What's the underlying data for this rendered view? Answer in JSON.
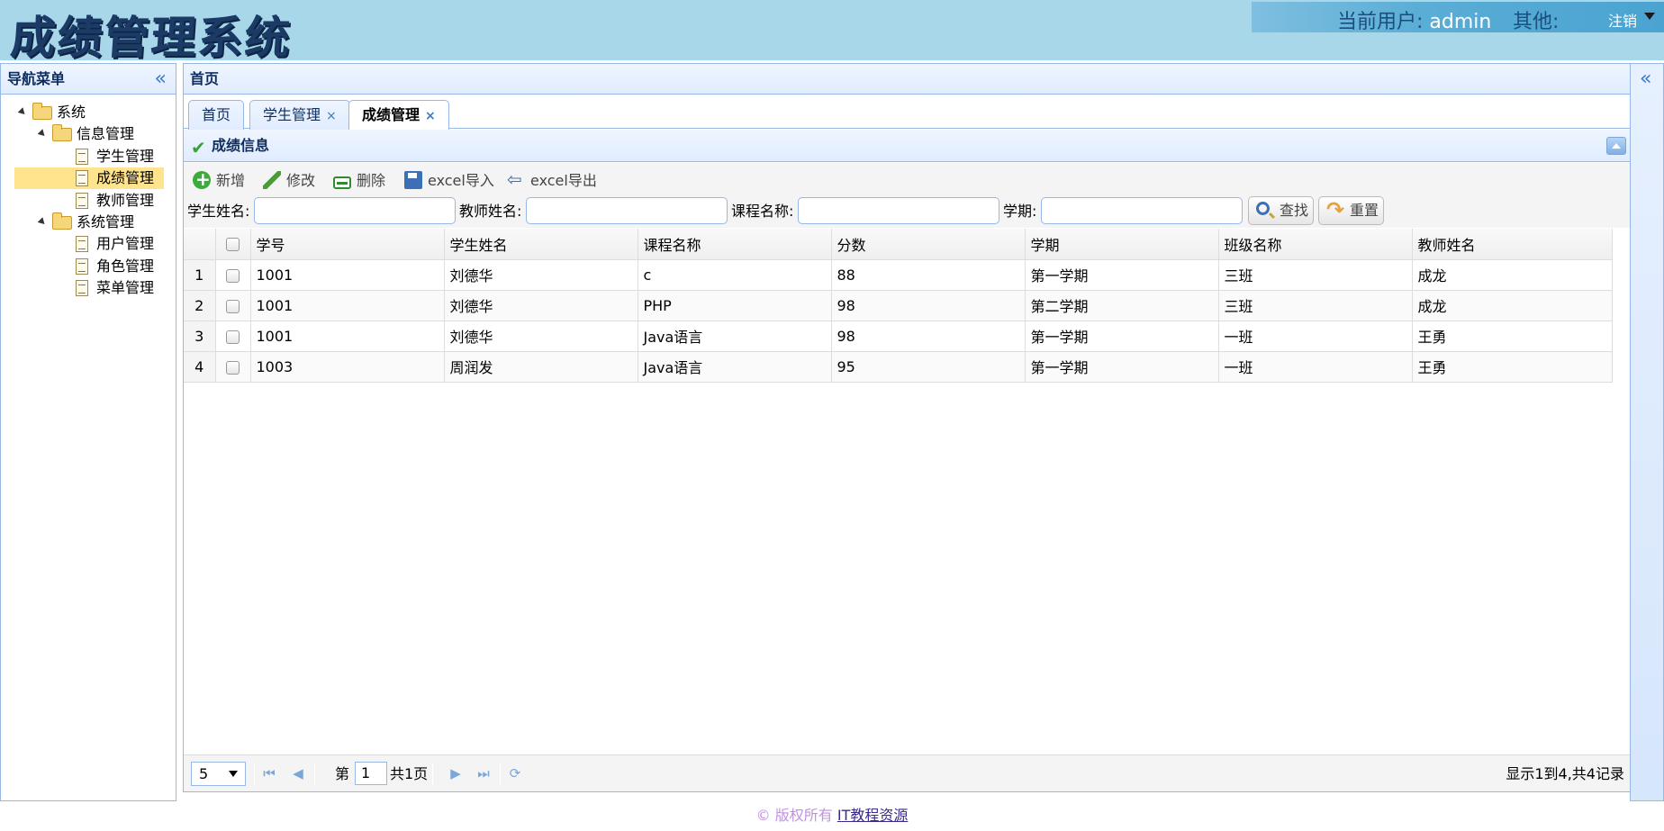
{
  "header": {
    "logo": "成绩管理系统",
    "current_user_label": "当前用户:",
    "current_user": "admin",
    "other_label": "其他:",
    "logout": "注销"
  },
  "nav": {
    "title": "导航菜单",
    "collapse_icon": "«",
    "tree": [
      {
        "label": "系统",
        "level": 0,
        "type": "folder"
      },
      {
        "label": "信息管理",
        "level": 1,
        "type": "folder"
      },
      {
        "label": "学生管理",
        "level": 2,
        "type": "file"
      },
      {
        "label": "成绩管理",
        "level": 2,
        "type": "file",
        "selected": true
      },
      {
        "label": "教师管理",
        "level": 2,
        "type": "file"
      },
      {
        "label": "系统管理",
        "level": 1,
        "type": "folder"
      },
      {
        "label": "用户管理",
        "level": 2,
        "type": "file"
      },
      {
        "label": "角色管理",
        "level": 2,
        "type": "file"
      },
      {
        "label": "菜单管理",
        "level": 2,
        "type": "file"
      }
    ]
  },
  "center": {
    "title": "首页",
    "tabs": [
      {
        "label": "首页",
        "closable": false
      },
      {
        "label": "学生管理",
        "closable": true
      },
      {
        "label": "成绩管理",
        "closable": true,
        "active": true
      }
    ],
    "tab_close": "×",
    "panel_title": "成绩信息",
    "toolbar": {
      "add": "新增",
      "edit": "修改",
      "delete": "删除",
      "import": "excel导入",
      "export": "excel导出"
    },
    "search": {
      "student_label": "学生姓名:",
      "teacher_label": "教师姓名:",
      "course_label": "课程名称:",
      "term_label": "学期:",
      "student_value": "",
      "teacher_value": "",
      "course_value": "",
      "term_value": "",
      "find": "查找",
      "reset": "重置"
    },
    "grid": {
      "columns": [
        "学号",
        "学生姓名",
        "课程名称",
        "分数",
        "学期",
        "班级名称",
        "教师姓名"
      ],
      "rows": [
        {
          "n": "1",
          "cells": [
            "1001",
            "刘德华",
            "c",
            "88",
            "第一学期",
            "三班",
            "成龙"
          ]
        },
        {
          "n": "2",
          "cells": [
            "1001",
            "刘德华",
            "PHP",
            "98",
            "第二学期",
            "三班",
            "成龙"
          ]
        },
        {
          "n": "3",
          "cells": [
            "1001",
            "刘德华",
            "Java语言",
            "98",
            "第一学期",
            "一班",
            "王勇"
          ]
        },
        {
          "n": "4",
          "cells": [
            "1003",
            "周润发",
            "Java语言",
            "95",
            "第一学期",
            "一班",
            "王勇"
          ]
        }
      ]
    },
    "pager": {
      "page_size": "5",
      "page_prefix": "第",
      "page_number": "1",
      "page_total": "共1页",
      "info": "显示1到4,共4记录"
    }
  },
  "east": {
    "collapse_icon": "«"
  },
  "footer": {
    "copyright": "© 版权所有",
    "link": "IT教程资源"
  },
  "colors": {
    "header_bg": "#a7d7e9",
    "border": "#95b8e7",
    "selected": "#ffe48d"
  }
}
